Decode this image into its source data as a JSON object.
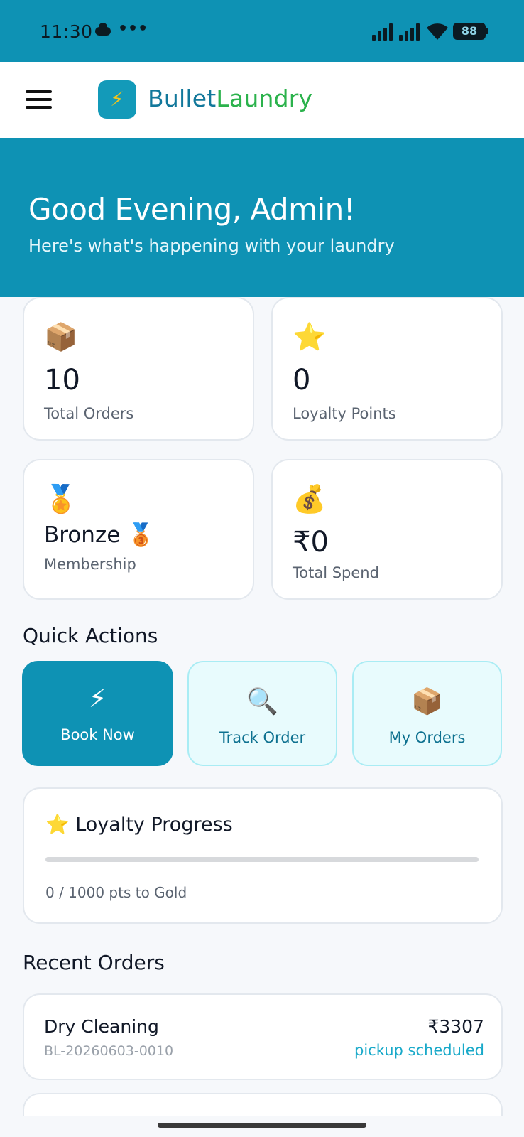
{
  "status_bar": {
    "time": "11:30",
    "dots": "•••",
    "battery": "88"
  },
  "header": {
    "brand_part1": "Bullet",
    "brand_part2": "Laundry",
    "logo_glyph": "⚡"
  },
  "hero": {
    "greeting": "Good Evening, Admin!",
    "subtitle": "Here's what's happening with your laundry"
  },
  "stats": [
    {
      "icon": "📦",
      "value": "10",
      "label": "Total Orders"
    },
    {
      "icon": "⭐",
      "value": "0",
      "label": "Loyalty Points"
    },
    {
      "icon": "🏅",
      "value": "Bronze 🥉",
      "label": "Membership"
    },
    {
      "icon": "💰",
      "value": "₹0",
      "label": "Total Spend"
    }
  ],
  "quick_actions": {
    "title": "Quick Actions",
    "items": [
      {
        "icon": "⚡",
        "label": "Book Now"
      },
      {
        "icon": "🔍",
        "label": "Track Order"
      },
      {
        "icon": "📦",
        "label": "My Orders"
      }
    ]
  },
  "loyalty": {
    "icon": "⭐",
    "title": "Loyalty Progress",
    "progress_text": "0 / 1000 pts to Gold",
    "progress_fraction": 0,
    "colors": {
      "track": "#d7d9dc",
      "fill": "#0e92b4"
    }
  },
  "recent_orders": {
    "title": "Recent Orders",
    "items": [
      {
        "service": "Dry Cleaning",
        "order_id": "BL-20260603-0010",
        "amount": "₹3307",
        "status": "pickup scheduled"
      }
    ]
  },
  "colors": {
    "primary": "#0e92b4",
    "brand_blue": "#12789b",
    "brand_green": "#2bb24c",
    "status_text": "#18a9c9"
  }
}
